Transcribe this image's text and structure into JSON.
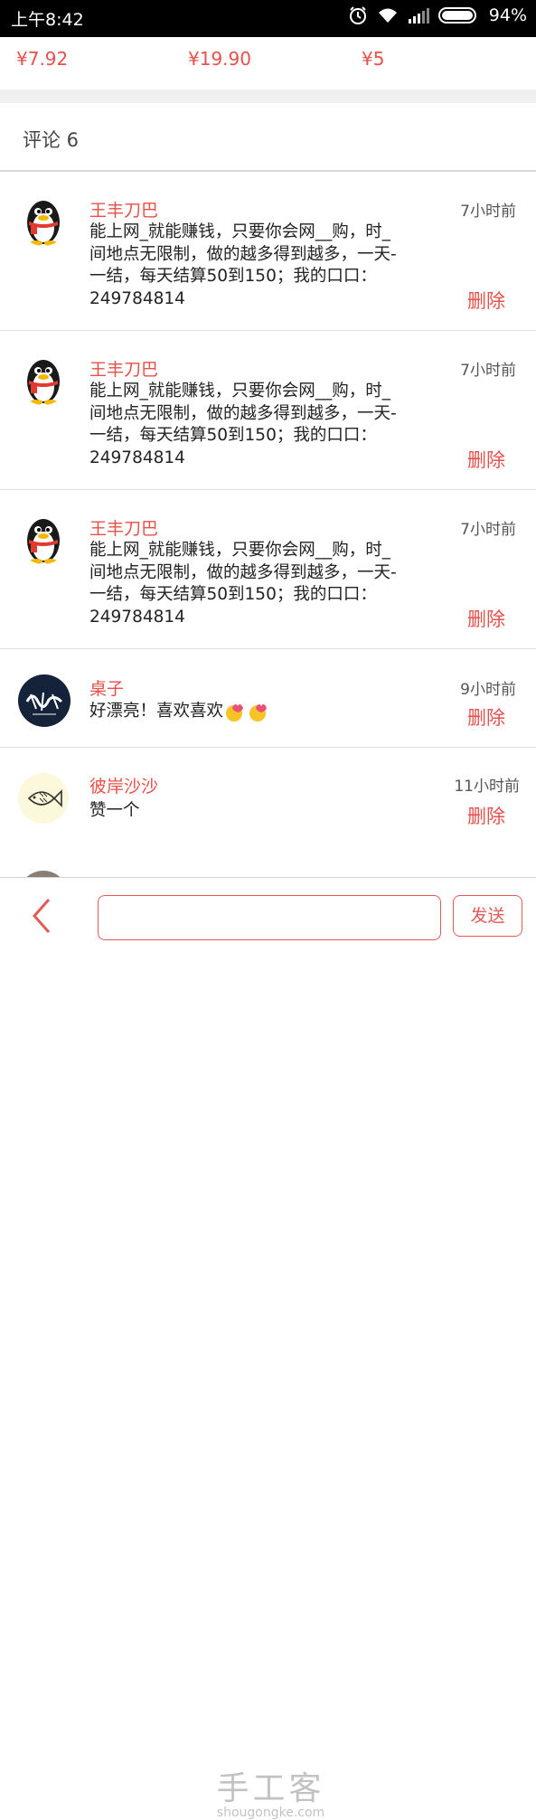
{
  "status_bar": {
    "time": "上午8:42",
    "battery": "94%"
  },
  "prices": [
    "¥7.92",
    "¥19.90",
    "¥5"
  ],
  "comments_header": {
    "label": "评论 6"
  },
  "comments": [
    {
      "name": "王丰刀巴",
      "time": "7小时前",
      "text": "能上网_就能赚钱，只要你会网__购，时_\n间地点无限制，做的越多得到越多，一天-\n一结，每天结算50到150；我的口口：\n249784814",
      "delete": "删除",
      "avatar": "qq-penguin"
    },
    {
      "name": "王丰刀巴",
      "time": "7小时前",
      "text": "能上网_就能赚钱，只要你会网__购，时_\n间地点无限制，做的越多得到越多，一天-\n一结，每天结算50到150；我的口口：\n249784814",
      "delete": "删除",
      "avatar": "qq-penguin"
    },
    {
      "name": "王丰刀巴",
      "time": "7小时前",
      "text": "能上网_就能赚钱，只要你会网__购，时_\n间地点无限制，做的越多得到越多，一天-\n一结，每天结算50到150；我的口口：\n249784814",
      "delete": "删除",
      "avatar": "qq-penguin"
    },
    {
      "name": "桌子",
      "time": "9小时前",
      "text": "好漂亮！喜欢喜欢",
      "delete": "删除",
      "avatar": "calligraphy-logo"
    },
    {
      "name": "彼岸沙沙",
      "time": "11小时前",
      "text": "赞一个",
      "delete": "删除",
      "avatar": "fish-sketch"
    }
  ],
  "bottom_bar": {
    "send_label": "发送",
    "input_value": ""
  },
  "watermark": {
    "title": "手工客",
    "url": "shougongke.com"
  },
  "colors": {
    "accent": "#e8504a",
    "status_bar": "#000000",
    "divider": "#e2e2e2"
  }
}
